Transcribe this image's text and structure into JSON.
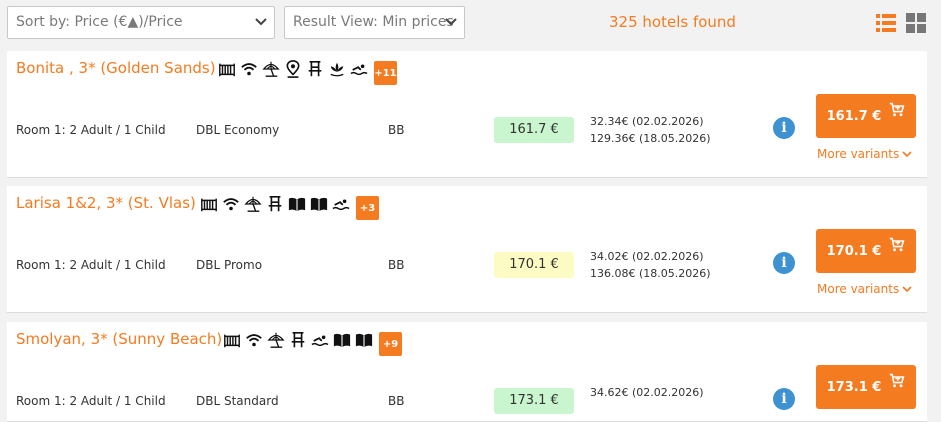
{
  "toolbar": {
    "sort_select": "Sort by: Price (€▲)/Price",
    "view_select": "Result View: Min prices",
    "hotels_found": "325 hotels found",
    "list_view_icon": "list-icon",
    "grid_view_icon": "grid-icon"
  },
  "colors": {
    "accent": "#f47b20",
    "info": "#3f92d2",
    "price_green": "#c9f5cf",
    "price_yellow": "#fdfbc4"
  },
  "hotels": [
    {
      "name": "Bonita , 3* (Golden Sands)",
      "amenities": [
        "crib-icon",
        "wifi-icon",
        "beach-umbrella-icon",
        "location-pin-icon",
        "beach-chair-icon",
        "spa-lotus-icon",
        "swimming-icon"
      ],
      "more_count": "+11",
      "room": "Room 1: 2 Adult / 1 Child",
      "room_type": "DBL Economy",
      "board": "BB",
      "price": "161.7 €",
      "price_tone": "green",
      "date_price_1": "32.34€ (02.02.2026)",
      "date_price_2": "129.36€ (18.05.2026)",
      "button_price": "161.7 €",
      "more_variants": "More variants"
    },
    {
      "name": "Larisa 1&2, 3* (St. Vlas)",
      "amenities": [
        "crib-icon",
        "wifi-icon",
        "beach-umbrella-icon",
        "beach-chair-icon",
        "book-icon",
        "book-icon",
        "swimming-icon"
      ],
      "more_count": "+3",
      "room": "Room 1: 2 Adult / 1 Child",
      "room_type": "DBL Promo",
      "board": "BB",
      "price": "170.1 €",
      "price_tone": "yellow",
      "date_price_1": "34.02€ (02.02.2026)",
      "date_price_2": "136.08€ (18.05.2026)",
      "button_price": "170.1 €",
      "more_variants": "More variants"
    },
    {
      "name": "Smolyan, 3* (Sunny Beach)",
      "amenities": [
        "crib-icon",
        "wifi-icon",
        "beach-umbrella-icon",
        "beach-chair-icon",
        "swimming-icon",
        "book-icon",
        "book-icon"
      ],
      "more_count": "+9",
      "room": "Room 1: 2 Adult / 1 Child",
      "room_type": "DBL Standard",
      "board": "BB",
      "price": "173.1 €",
      "price_tone": "green",
      "date_price_1": "34.62€ (02.02.2026)",
      "date_price_2": "",
      "button_price": "173.1 €",
      "more_variants": ""
    }
  ]
}
